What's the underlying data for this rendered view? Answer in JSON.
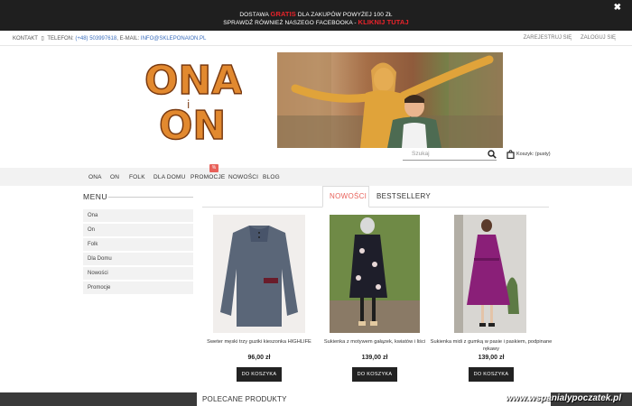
{
  "promo": {
    "line1_pre": "DOSTAWA",
    "line1_red": "GRATIS",
    "line1_post": "DLA ZAKUPÓW POWYŻEJ 100 ZŁ",
    "line2_pre": "SPRAWDŹ RÓWNIEŻ NASZEGO FACEBOOKA -",
    "line2_link": "KLIKNIJ TUTAJ",
    "close_icon": "close-icon"
  },
  "contact": {
    "kontakt": "KONTAKT",
    "telefon_label": "TELEFON:",
    "telefon_value": "(+48) 503997618",
    "email_label": "E-MAIL:",
    "email_value": "INFO@SKLEPONAION.PL",
    "register": "ZAREJESTRUJ SIĘ",
    "login": "ZALOGUJ SIĘ"
  },
  "logo": {
    "top": "ONA",
    "mid": "i",
    "bottom": "ON"
  },
  "search": {
    "placeholder": "Szukaj"
  },
  "cart": {
    "label": "Koszyk: (pusty)"
  },
  "nav": {
    "items": [
      "ONA",
      "ON",
      "FOLK",
      "DLA DOMU",
      "PROMOCJE",
      "NOWOŚCI",
      "BLOG"
    ],
    "badge": "%"
  },
  "sidebar": {
    "title": "MENU",
    "items": [
      "Ona",
      "On",
      "Folk",
      "Dla Domu",
      "Nowości",
      "Promocje"
    ]
  },
  "tabs": {
    "active": "NOWOŚCI",
    "other": "BESTSELLERY"
  },
  "products": [
    {
      "name": "Sweter męski trzy guziki kieszonka HIGHLIFE",
      "price": "96,00 zł",
      "button": "DO KOSZYKA"
    },
    {
      "name": "Sukienka z motywem gałązek, kwiatów i liści",
      "price": "139,00 zł",
      "button": "DO KOSZYKA"
    },
    {
      "name": "Sukienka midi z gumką w pasie i paskiem, podpinane rękawy",
      "price": "139,00 zł",
      "button": "DO KOSZYKA"
    }
  ],
  "polecane": "POLECANE PRODUKTY",
  "watermark": "www.wspanialypoczatek.pl",
  "colors": {
    "accent": "#e8615a",
    "promo_red": "#e8232a",
    "dark": "#222222"
  }
}
